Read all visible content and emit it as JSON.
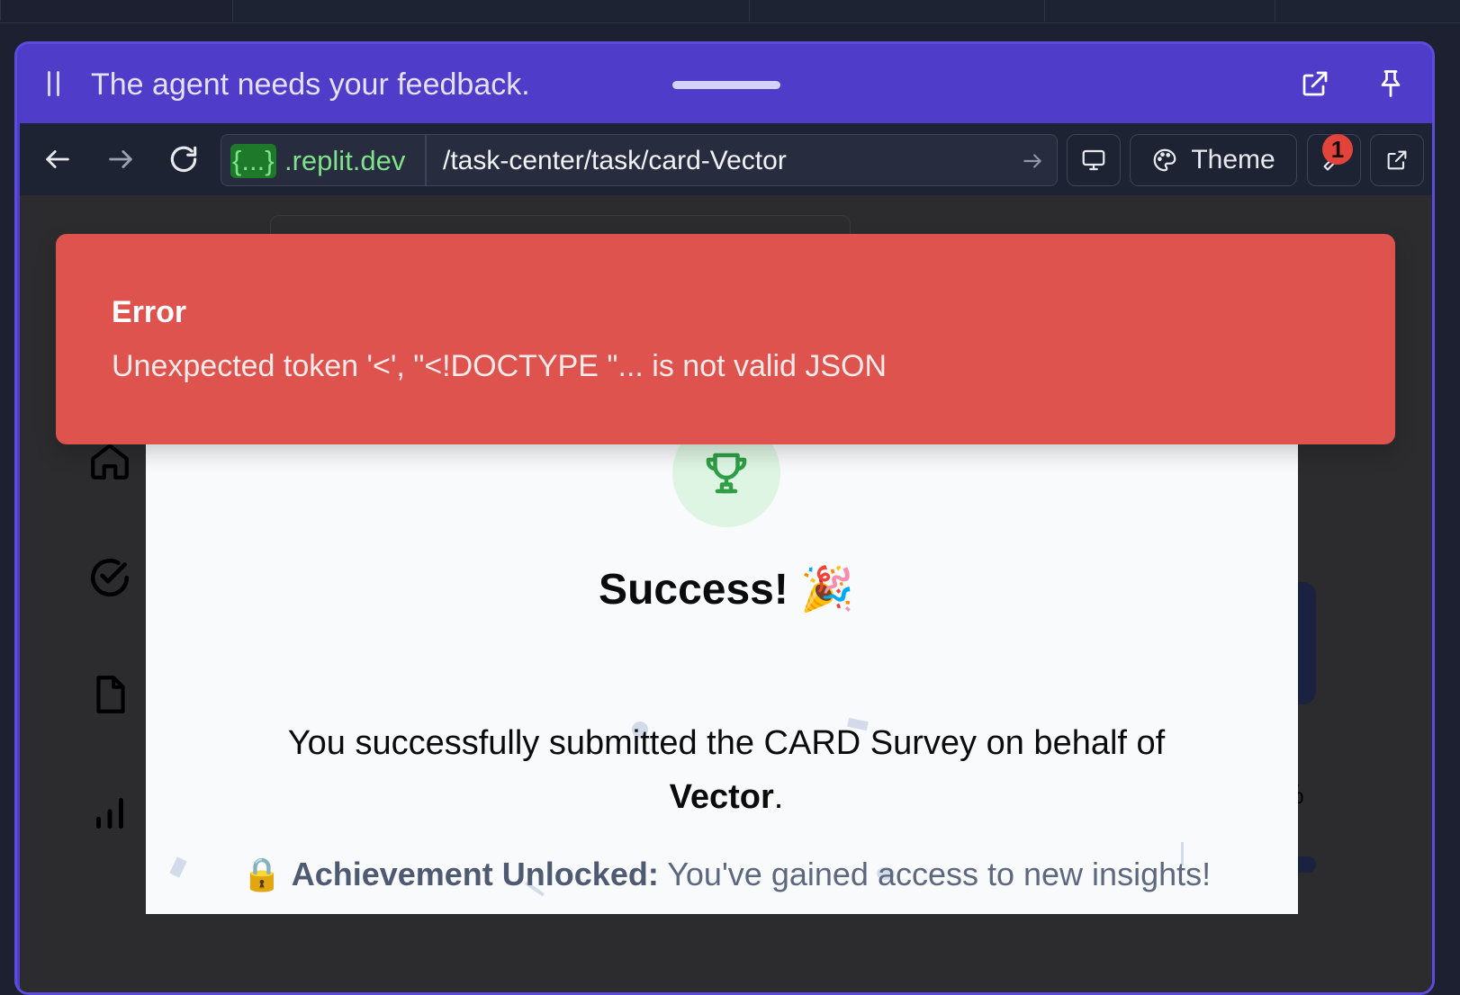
{
  "banner": {
    "message": "The agent needs your feedback."
  },
  "browser": {
    "domain_chip": "{...}",
    "domain_rest": ".replit.dev",
    "path": "/task-center/task/card-Vector",
    "theme_label": "Theme",
    "notification_count": "1"
  },
  "toast": {
    "title": "Error",
    "message": "Unexpected token '<', \"<!DOCTYPE \"... is not valid JSON"
  },
  "modal": {
    "title": "Success!",
    "title_emoji": "🎉",
    "desc_prefix": "You successfully submitted the CARD Survey on behalf of",
    "org": "Vector",
    "desc_suffix": ".",
    "achievement_emoji": "🔒",
    "achievement_label": "Achievement Unlocked:",
    "achievement_text": "You've gained access to new insights!"
  },
  "background": {
    "percent_fragment": "%"
  },
  "colors": {
    "banner": "#4f3cc8",
    "toast": "#de534d",
    "trophy": "#2f9e47",
    "domain": "#7ee28a"
  }
}
